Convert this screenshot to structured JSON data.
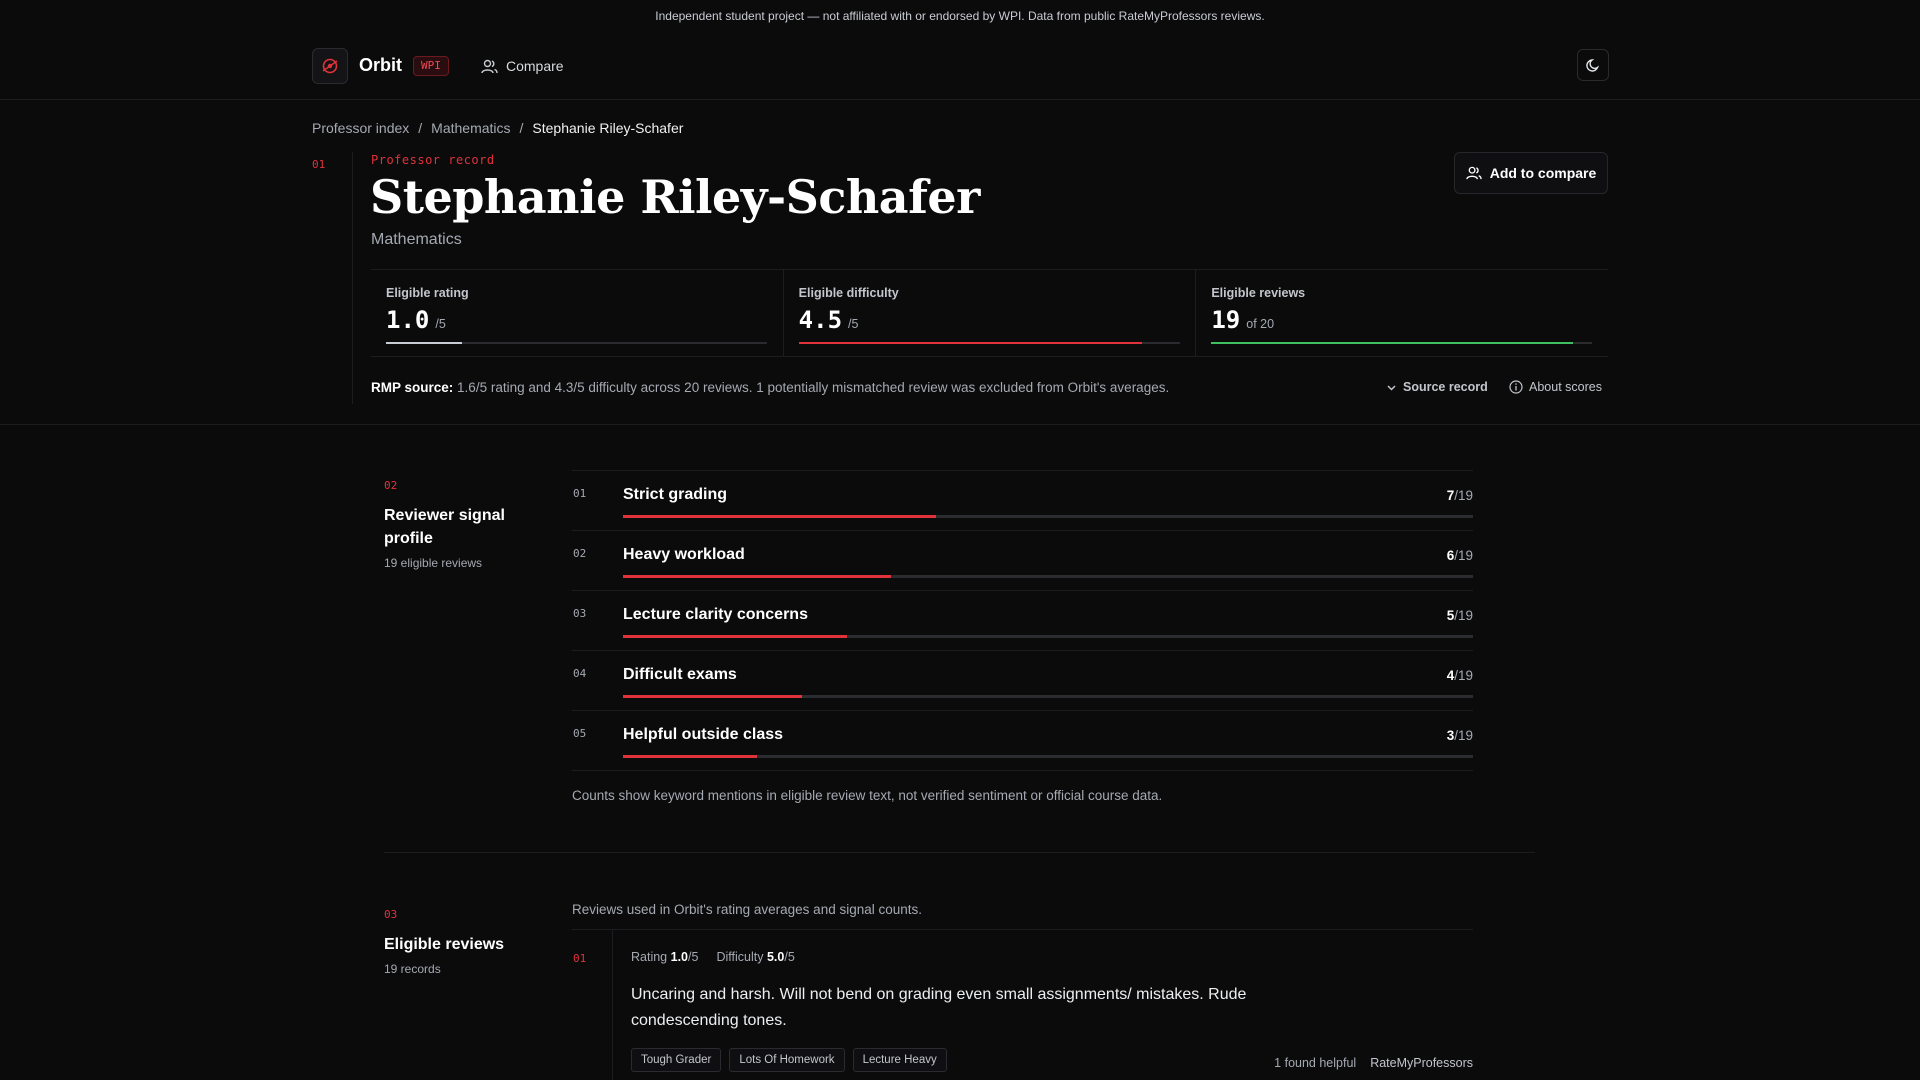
{
  "disclaimer": "Independent student project — not affiliated with or endorsed by WPI. Data from public RateMyProfessors reviews.",
  "header": {
    "brand": "Orbit",
    "badge": "WPI",
    "nav_compare": "Compare",
    "icons": {
      "logo": "orbit-logo-icon",
      "compare": "users-icon",
      "theme": "moon-icon"
    }
  },
  "breadcrumb": {
    "items": [
      "Professor index",
      "Mathematics"
    ],
    "current": "Stephanie Riley-Schafer",
    "separator": "/"
  },
  "record": {
    "section_num": "01",
    "label": "Professor record",
    "name": "Stephanie Riley-Schafer",
    "department": "Mathematics",
    "add_compare": "Add to compare",
    "stats": [
      {
        "label": "Eligible rating",
        "value": "1.0",
        "suffix": "/5",
        "fraction": 0.2,
        "color": "#c8ccd4"
      },
      {
        "label": "Eligible difficulty",
        "value": "4.5",
        "suffix": "/5",
        "fraction": 0.9,
        "color": "#e0323b"
      },
      {
        "label": "Eligible reviews",
        "value": "19",
        "suffix": "of 20",
        "fraction": 0.95,
        "color": "#3fbf5f"
      }
    ],
    "rmp_label": "RMP source:",
    "rmp_text": "1.6/5 rating and 4.3/5 difficulty across 20 reviews. 1 potentially mismatched review was excluded from Orbit's averages.",
    "source_record": "Source record",
    "about_scores": "About scores"
  },
  "signals": {
    "section_num": "02",
    "title": "Reviewer signal profile",
    "subtitle": "19 eligible reviews",
    "total": "19",
    "items": [
      {
        "num": "01",
        "label": "Strict grading",
        "count": 7
      },
      {
        "num": "02",
        "label": "Heavy workload",
        "count": 6
      },
      {
        "num": "03",
        "label": "Lecture clarity concerns",
        "count": 5
      },
      {
        "num": "04",
        "label": "Difficult exams",
        "count": 4
      },
      {
        "num": "05",
        "label": "Helpful outside class",
        "count": 3
      }
    ],
    "note": "Counts show keyword mentions in eligible review text, not verified sentiment or official course data."
  },
  "reviews": {
    "section_num": "03",
    "title": "Eligible reviews",
    "subtitle": "19 records",
    "intro": "Reviews used in Orbit's rating averages and signal counts.",
    "items": [
      {
        "num": "01",
        "rating_label": "Rating",
        "rating": "1.0",
        "difficulty_label": "Difficulty",
        "difficulty": "5.0",
        "scale": "/5",
        "text": "Uncaring and harsh. Will not bend on grading even small assignments/ mistakes. Rude condescending tones.",
        "tags": [
          "Tough Grader",
          "Lots Of Homework",
          "Lecture Heavy"
        ],
        "helpful": "1 found helpful",
        "source": "RateMyProfessors"
      }
    ]
  }
}
